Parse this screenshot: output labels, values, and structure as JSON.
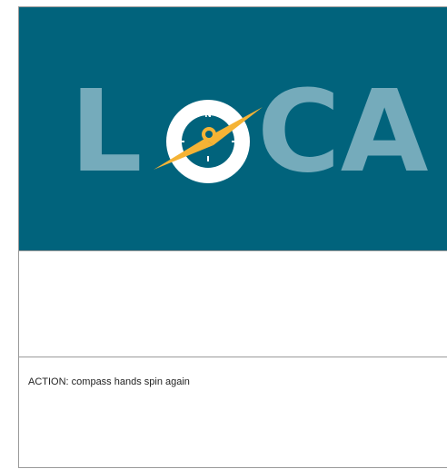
{
  "storyboard": {
    "logo": {
      "letters_before_icon": "L",
      "letters_after_icon": "CA",
      "compass_label": "N",
      "icon": "compass-icon",
      "colors": {
        "background": "#01637c",
        "letters": "#75abbb",
        "needle": "#f5b335",
        "ring": "#ffffff"
      }
    },
    "action": {
      "text": "ACTION: compass hands spin again"
    }
  }
}
